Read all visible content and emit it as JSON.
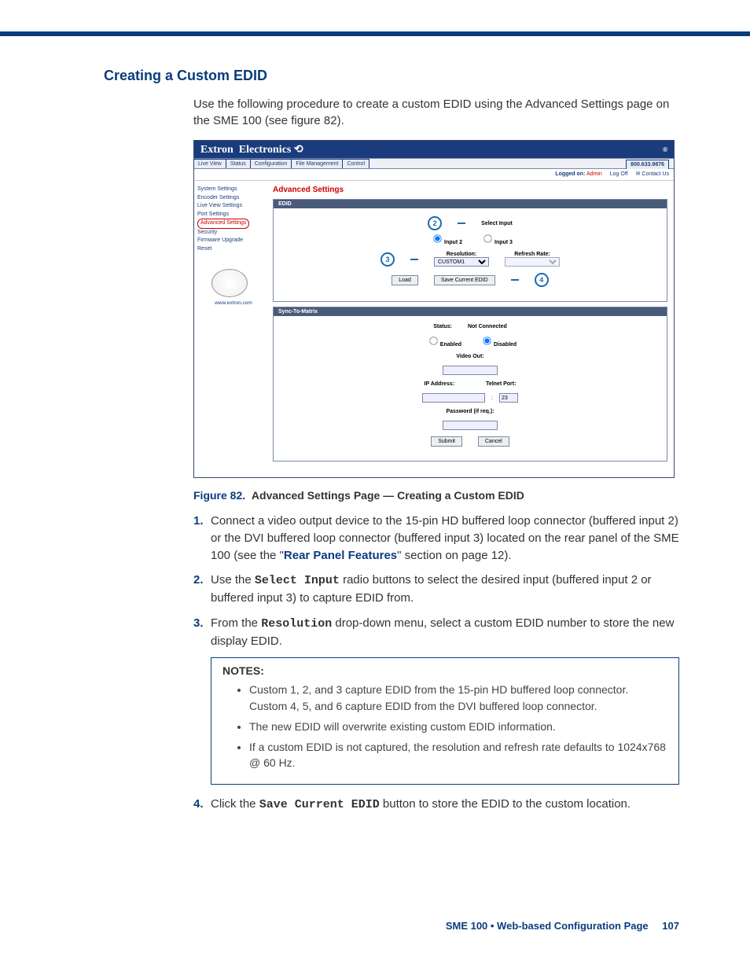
{
  "heading": "Creating a Custom EDID",
  "intro": "Use the following procedure to create a custom EDID using the Advanced Settings page on the SME 100 (see figure 82).",
  "figcap_label": "Figure 82.",
  "figcap_text": "Advanced Settings Page — Creating a Custom EDID",
  "steps": {
    "s1a": "Connect a video output device to the 15-pin HD buffered loop connector (buffered input 2) or the DVI buffered loop connector (buffered input 3) located on the rear panel of the SME 100 (see the \"",
    "s1link": "Rear Panel Features",
    "s1b": "\" section on page 12).",
    "s2a": "Use the ",
    "s2m": "Select Input",
    "s2b": " radio buttons to select the desired input (buffered input 2 or buffered input 3) to capture EDID from.",
    "s3a": "From the ",
    "s3m": "Resolution",
    "s3b": " drop-down menu, select a custom EDID number to store the new display EDID.",
    "s4a": "Click the ",
    "s4m": "Save Current EDID",
    "s4b": " button to store the EDID to the custom location."
  },
  "notes": {
    "title": "NOTES:",
    "n1": "Custom 1, 2, and 3 capture EDID from the 15-pin HD buffered loop connector. Custom 4, 5, and 6 capture EDID from the DVI buffered loop connector.",
    "n2": "The new EDID will overwrite existing custom EDID information.",
    "n3": "If a custom EDID is not captured, the resolution and refresh rate defaults to 1024x768 @ 60 Hz."
  },
  "footer": {
    "prod": "SME 100 • Web-based Configuration Page",
    "page": "107"
  },
  "shot": {
    "brand": "Extron  Electronics ⟲",
    "reg": "®",
    "tabs": [
      "Live View",
      "Status",
      "Configuration",
      "File Management",
      "Control"
    ],
    "phone": "800.633.9876",
    "logrow": {
      "lbl": "Logged on:",
      "user": "Admin",
      "logoff": "Log Off",
      "contact": "✉ Contact Us"
    },
    "side": {
      "items": [
        "System Settings",
        "Encoder Settings",
        "Live View Settings",
        "Port Settings"
      ],
      "selected": "Advanced Settings",
      "items2": [
        "Security",
        "Firmware Upgrade",
        "Reset"
      ],
      "url": "www.extron.com"
    },
    "rt_title": "Advanced Settings",
    "edid": {
      "title": "EDID",
      "select_label": "Select Input",
      "input2": "Input 2",
      "input3": "Input 3",
      "res_label": "Resolution:",
      "res_value": "CUSTOM1",
      "rate_label": "Refresh Rate:",
      "load": "Load",
      "save": "Save Current EDID"
    },
    "sync": {
      "title": "Sync-To-Matrix",
      "status_label": "Status:",
      "status_value": "Not Connected",
      "enabled": "Enabled",
      "disabled": "Disabled",
      "video_out": "Video Out:",
      "ip": "IP Address:",
      "telnet": "Telnet Port:",
      "telnet_val": "23",
      "pwd": "Password (if req.):",
      "submit": "Submit",
      "cancel": "Cancel"
    },
    "callouts": {
      "c2": "2",
      "c3": "3",
      "c4": "4"
    }
  }
}
